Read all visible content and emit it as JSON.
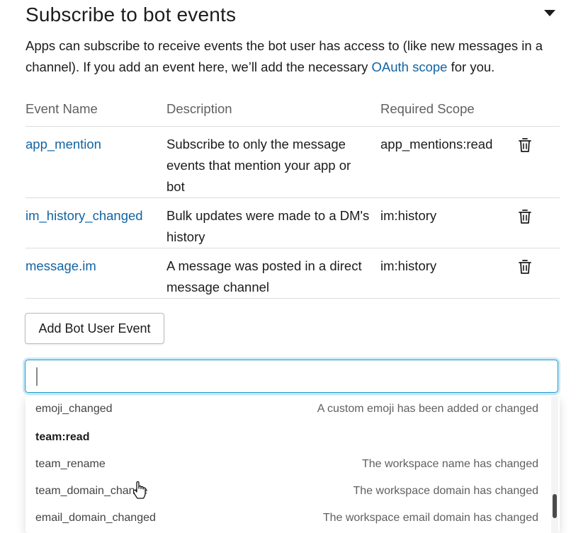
{
  "section": {
    "title": "Subscribe to bot events",
    "intro_prefix": "Apps can subscribe to receive events the bot user has access to (like new messages in a channel). If you add an event here, we’ll add the necessary ",
    "intro_link": "OAuth scope",
    "intro_suffix": " for you."
  },
  "table": {
    "headers": {
      "name": "Event Name",
      "description": "Description",
      "scope": "Required Scope"
    },
    "rows": [
      {
        "name": "app_mention",
        "description": "Subscribe to only the message events that mention your app or bot",
        "scope": "app_mentions:read"
      },
      {
        "name": "im_history_changed",
        "description": "Bulk updates were made to a DM's history",
        "scope": "im:history"
      },
      {
        "name": "message.im",
        "description": "A message was posted in a direct message channel",
        "scope": "im:history"
      }
    ]
  },
  "add_button": {
    "label": "Add Bot User Event"
  },
  "search": {
    "value": "",
    "placeholder": ""
  },
  "dropdown": {
    "items": [
      {
        "kind": "option",
        "name": "emoji_changed",
        "description": "A custom emoji has been added or changed"
      },
      {
        "kind": "group",
        "name": "team:read"
      },
      {
        "kind": "option",
        "name": "team_rename",
        "description": "The workspace name has changed"
      },
      {
        "kind": "option",
        "name": "team_domain_change",
        "description": "The workspace domain has changed"
      },
      {
        "kind": "option",
        "name": "email_domain_changed",
        "description": "The workspace email domain has changed"
      }
    ]
  },
  "colors": {
    "link": "#1264a3",
    "focus_border": "#1d9bd1"
  }
}
